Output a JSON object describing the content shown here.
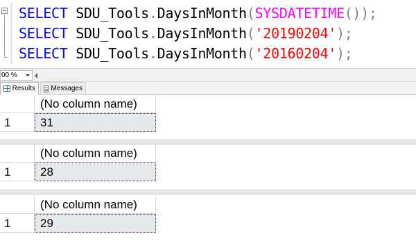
{
  "editor": {
    "lines": [
      [
        {
          "t": "SELECT",
          "c": "kw"
        },
        {
          "t": " ",
          "c": "tx"
        },
        {
          "t": "SDU_Tools",
          "c": "tx"
        },
        {
          "t": ".",
          "c": "pn"
        },
        {
          "t": "DaysInMonth",
          "c": "tx"
        },
        {
          "t": "(",
          "c": "pn"
        },
        {
          "t": "SYSDATETIME",
          "c": "fn"
        },
        {
          "t": "());",
          "c": "pn"
        }
      ],
      [
        {
          "t": "SELECT",
          "c": "kw"
        },
        {
          "t": " ",
          "c": "tx"
        },
        {
          "t": "SDU_Tools",
          "c": "tx"
        },
        {
          "t": ".",
          "c": "pn"
        },
        {
          "t": "DaysInMonth",
          "c": "tx"
        },
        {
          "t": "(",
          "c": "pn"
        },
        {
          "t": "'20190204'",
          "c": "st"
        },
        {
          "t": ");",
          "c": "pn"
        }
      ],
      [
        {
          "t": "SELECT",
          "c": "kw"
        },
        {
          "t": " ",
          "c": "tx"
        },
        {
          "t": "SDU_Tools",
          "c": "tx"
        },
        {
          "t": ".",
          "c": "pn"
        },
        {
          "t": "DaysInMonth",
          "c": "tx"
        },
        {
          "t": "(",
          "c": "pn"
        },
        {
          "t": "'20160204'",
          "c": "st"
        },
        {
          "t": ");",
          "c": "pn"
        }
      ]
    ]
  },
  "zoom": {
    "value": "00 %"
  },
  "tabs": {
    "results": "Results",
    "messages": "Messages"
  },
  "results": [
    {
      "column": "(No column name)",
      "row_number": "1",
      "value": "31"
    },
    {
      "column": "(No column name)",
      "row_number": "1",
      "value": "28"
    },
    {
      "column": "(No column name)",
      "row_number": "1",
      "value": "29"
    }
  ],
  "colors": {
    "keyword": "#0000ff",
    "function": "#ff00ff",
    "string": "#ff0000",
    "punctuation": "#808080"
  }
}
